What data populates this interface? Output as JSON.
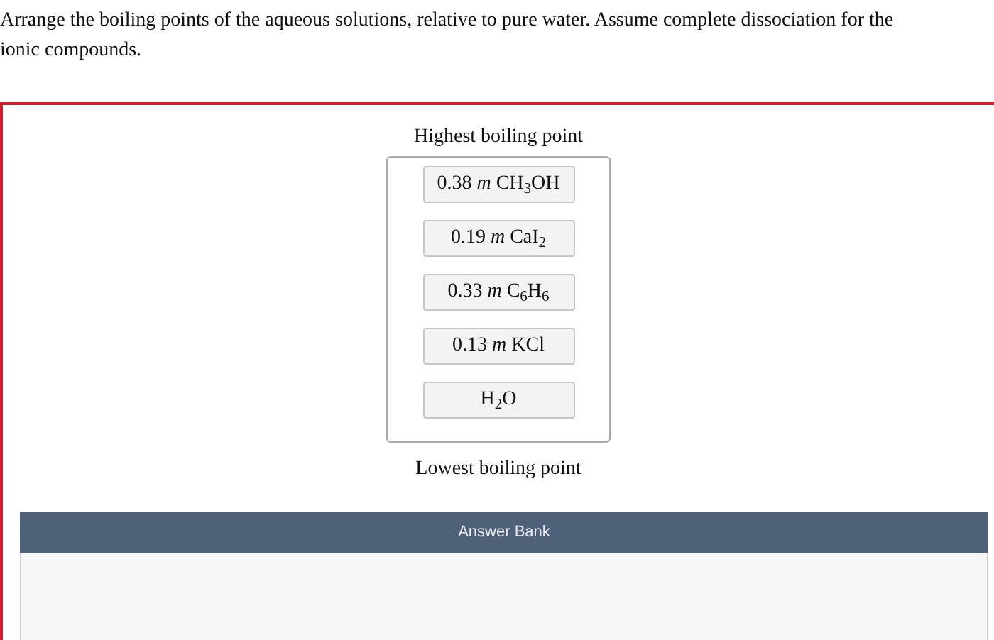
{
  "question": "Arrange the boiling points of the aqueous solutions, relative to pure water. Assume complete dissociation for the ionic compounds.",
  "ranking": {
    "top_label": "Highest boiling point",
    "bottom_label": "Lowest boiling point",
    "items": [
      {
        "text": "0.38 *m* CH$_{3}$OH"
      },
      {
        "text": "0.19 *m* CaI$_{2}$"
      },
      {
        "text": "0.33 *m* C$_{6}$H$_{6}$"
      },
      {
        "text": "0.13 *m* KCl"
      },
      {
        "text": "H$_{2}$O"
      }
    ]
  },
  "answer_bank": {
    "title": "Answer Bank"
  }
}
